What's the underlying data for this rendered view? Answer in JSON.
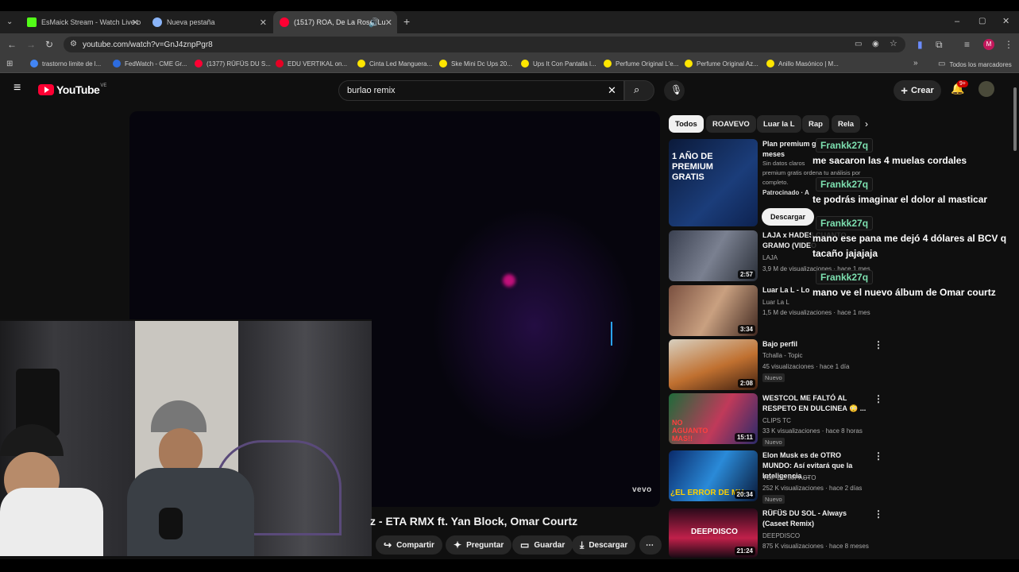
{
  "browser": {
    "tabs": [
      {
        "label": "EsMaick Stream - Watch Live o",
        "color": "#53fc18"
      },
      {
        "label": "Nueva pestaña",
        "color": "#8ab4f8"
      },
      {
        "label": "(1517) ROA, De La Rose, Lu",
        "color": "#ff0033"
      }
    ],
    "url": "youtube.com/watch?v=GnJ4znpPgr8",
    "bookmarks": [
      "trastorno limite de l...",
      "FedWatch - CME Gr...",
      "(1377) RÜFÜS DU S...",
      "EDU VERTIKAL on...",
      "Cinta Led Manguera...",
      "Ske Mini Dc Ups 20...",
      "Ups It Con Pantalla l...",
      "Perfume Original L'e...",
      "Perfume Original Az...",
      "Anillo Masónico | M..."
    ],
    "all_bookmarks": "Todos los marcadores"
  },
  "youtube": {
    "logo": "YouTube",
    "region": "VE",
    "search_value": "burlao remix",
    "create_label": "Crear",
    "notif_badge": "9+"
  },
  "video": {
    "title": "z - ETA RMX ft. Yan Block, Omar Courtz",
    "watermark": "vevo",
    "actions": [
      "Compartir",
      "Preguntar",
      "Guardar",
      "Descargar"
    ]
  },
  "chips": [
    "Todos",
    "ROAVEVO",
    "Luar la L",
    "Rap",
    "Rela"
  ],
  "ad": {
    "title": "Plan premium g",
    "title2": "meses",
    "desc1": "Sin datos claros",
    "desc2": "premium gratis ordena tu análisis por",
    "desc3": "completo.",
    "sponsor": "Patrocinado · A",
    "cta": "Descargar",
    "thumb_text": "1 AÑO DE PREMIUM GRATIS"
  },
  "videos": [
    {
      "title": "LAJA x HADES CUANTO GRAMO (VIDEO",
      "channel": "LAJA",
      "meta": "3,9 M de visualizaciones · hace 1 mes",
      "duration": "2:57",
      "new": ""
    },
    {
      "title": "Luar La L - Lo",
      "channel": "Luar La L",
      "meta": "1,5 M de visualizaciones · hace 1 mes",
      "duration": "3:34",
      "new": ""
    },
    {
      "title": "Bajo perfil",
      "channel": "Tchalla - Topic",
      "meta": "45 visualizaciones · hace 1 día",
      "duration": "2:08",
      "new": "Nuevo"
    },
    {
      "title": "WESTCOL ME FALTÓ AL RESPETO EN DULCINEA 😳 ...",
      "channel": "CLIPS TC",
      "meta": "33 K visualizaciones · hace 8 horas",
      "duration": "15:11",
      "new": "Nuevo",
      "thumb_text": "NO AGUANTO MAS!!"
    },
    {
      "title": "Elon Musk es de OTRO MUNDO: Así evitará que la Inteligencia ...",
      "channel": "TOP DE IMPACTO",
      "meta": "252 K visualizaciones · hace 2 días",
      "duration": "20:34",
      "new": "Nuevo",
      "thumb_text": "¿EL ERROR DE MU"
    },
    {
      "title": "RÜFÜS DU SOL - Always (Caseet Remix)",
      "channel": "DEEPDISCO",
      "meta": "875 K visualizaciones · hace 8 meses",
      "duration": "21:24",
      "new": "",
      "thumb_text": "DEEPDISCO"
    }
  ],
  "chat": [
    {
      "user": "Frankk27q",
      "message": "me sacaron las 4 muelas cordales"
    },
    {
      "user": "Frankk27q",
      "message": "te podrás imaginar el dolor al masticar"
    },
    {
      "user": "Frankk27q",
      "message": "mano ese pana me dejó 4 dólares al BCV q tacaño jajajaja"
    },
    {
      "user": "Frankk27q",
      "message": "mano ve el nuevo álbum de Omar courtz"
    }
  ],
  "colors": {
    "accent": "#ff0033",
    "chat_name": "#7de0b0",
    "profile": "#c2185b"
  }
}
